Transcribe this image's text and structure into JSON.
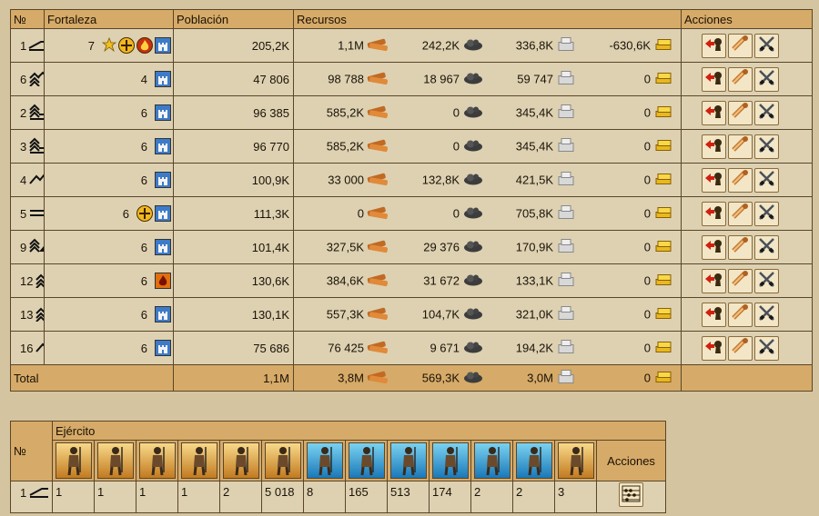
{
  "headers": {
    "no": "№",
    "fortaleza": "Fortaleza",
    "poblacion": "Población",
    "recursos": "Recursos",
    "acciones": "Acciones"
  },
  "rows": [
    {
      "num": "1",
      "terrain": "flat-hill",
      "level": "7",
      "pop": "205,2K",
      "wood": "1,1M",
      "stone": "242,2K",
      "iron": "336,8K",
      "gold": "-630,6K",
      "buildings": [
        "star",
        "shield",
        "fire",
        "castle"
      ]
    },
    {
      "num": "6",
      "terrain": "mountains-chevrons",
      "level": "4",
      "pop": "47 806",
      "wood": "98 788",
      "stone": "18 967",
      "iron": "59 747",
      "gold": "0",
      "buildings": [
        "castle"
      ]
    },
    {
      "num": "2",
      "terrain": "stacked-lines",
      "level": "6",
      "pop": "96 385",
      "wood": "585,2K",
      "stone": "0",
      "iron": "345,4K",
      "gold": "0",
      "buildings": [
        "castle"
      ]
    },
    {
      "num": "3",
      "terrain": "stacked-lines",
      "level": "6",
      "pop": "96 770",
      "wood": "585,2K",
      "stone": "0",
      "iron": "345,4K",
      "gold": "0",
      "buildings": [
        "castle"
      ]
    },
    {
      "num": "4",
      "terrain": "peaks",
      "level": "6",
      "pop": "100,9K",
      "wood": "33 000",
      "stone": "132,8K",
      "iron": "421,5K",
      "gold": "0",
      "buildings": [
        "castle"
      ]
    },
    {
      "num": "5",
      "terrain": "flat",
      "level": "6",
      "pop": "111,3K",
      "wood": "0",
      "stone": "0",
      "iron": "705,8K",
      "gold": "0",
      "buildings": [
        "shield",
        "castle"
      ]
    },
    {
      "num": "9",
      "terrain": "stacked-hills",
      "level": "6",
      "pop": "101,4K",
      "wood": "327,5K",
      "stone": "29 376",
      "iron": "170,9K",
      "gold": "0",
      "buildings": [
        "castle"
      ]
    },
    {
      "num": "12",
      "terrain": "mountains-chevrons",
      "level": "6",
      "pop": "130,6K",
      "wood": "384,6K",
      "stone": "31 672",
      "iron": "133,1K",
      "gold": "0",
      "buildings": [
        "burning-castle"
      ]
    },
    {
      "num": "13",
      "terrain": "mountains-chevrons",
      "level": "6",
      "pop": "130,1K",
      "wood": "557,3K",
      "stone": "104,7K",
      "iron": "321,0K",
      "gold": "0",
      "buildings": [
        "castle"
      ]
    },
    {
      "num": "16",
      "terrain": "peaks",
      "level": "6",
      "pop": "75 686",
      "wood": "76 425",
      "stone": "9 671",
      "iron": "194,2K",
      "gold": "0",
      "buildings": [
        "castle"
      ]
    }
  ],
  "total": {
    "label": "Total",
    "pop": "1,1M",
    "wood": "3,8M",
    "stone": "569,3K",
    "iron": "3,0M",
    "gold": "0"
  },
  "action_icons": [
    "keyhole-arrow-icon",
    "scroll-icon",
    "crossed-swords-icon"
  ],
  "army": {
    "header_no": "№",
    "title": "Ejército",
    "acciones": "Acciones",
    "units": [
      {
        "icon": "spearman-unit-icon",
        "frame": "gold"
      },
      {
        "icon": "swordsman-unit-icon",
        "frame": "gold"
      },
      {
        "icon": "archer-unit-icon",
        "frame": "gold"
      },
      {
        "icon": "light-cavalry-unit-icon",
        "frame": "gold"
      },
      {
        "icon": "ballista-unit-icon",
        "frame": "gold"
      },
      {
        "icon": "hero-unit-icon",
        "frame": "gold"
      },
      {
        "icon": "elite-spearman-unit-icon",
        "frame": "blue"
      },
      {
        "icon": "elite-swordsman-unit-icon",
        "frame": "blue"
      },
      {
        "icon": "elite-archer-unit-icon",
        "frame": "blue"
      },
      {
        "icon": "heavy-cavalry-unit-icon",
        "frame": "blue"
      },
      {
        "icon": "catapult-unit-icon",
        "frame": "blue"
      },
      {
        "icon": "trebuchet-unit-icon",
        "frame": "blue"
      },
      {
        "icon": "wagon-unit-icon",
        "frame": "gold"
      }
    ],
    "row": {
      "num": "1",
      "terrain": "flat-hill",
      "values": [
        "1",
        "1",
        "1",
        "1",
        "2",
        "5 018",
        "8",
        "165",
        "513",
        "174",
        "2",
        "2",
        "3"
      ]
    }
  },
  "colors": {
    "bg": "#d4c4a0",
    "header": "#d6aa68",
    "row": "#ddd1b2",
    "border": "#5a4628"
  }
}
